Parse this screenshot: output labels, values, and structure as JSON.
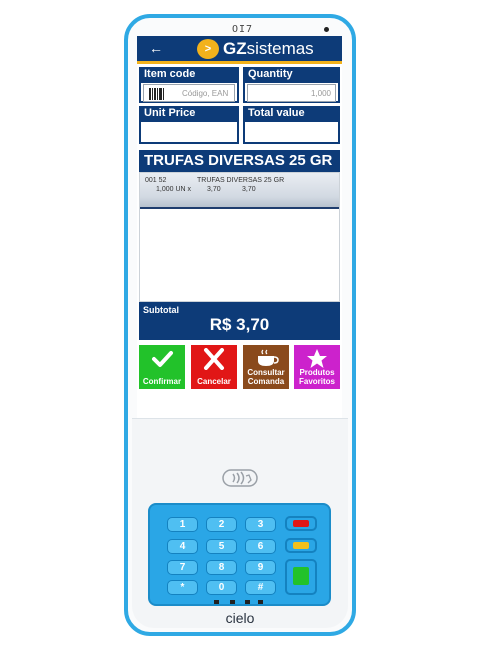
{
  "device": {
    "speaker_label": "OI7",
    "brand": "cielo"
  },
  "header": {
    "back_icon": "←",
    "logo_mark": ">",
    "logo_bold": "GZ",
    "logo_rest": "sistemas"
  },
  "form": {
    "item_code_label": "Item code",
    "item_code_placeholder": "Código, EAN",
    "quantity_label": "Quantity",
    "quantity_value": "1,000",
    "unit_price_label": "Unit Price",
    "total_value_label": "Total value"
  },
  "product_title": "TRUFAS DIVERSAS 25 GR",
  "items": [
    {
      "code": "001 52",
      "description": "TRUFAS DIVERSAS 25 GR",
      "qty": "1,000 UN x",
      "unit_price": "3,70",
      "total": "3,70"
    }
  ],
  "subtotal": {
    "label": "Subtotal",
    "value": "R$ 3,70"
  },
  "actions": [
    {
      "label": "Confirmar",
      "color": "#22c22a",
      "icon": "checkmark-icon"
    },
    {
      "label": "Cancelar",
      "color": "#e11616",
      "icon": "x-icon"
    },
    {
      "label": "Consultar Comanda",
      "color": "#8a4a1c",
      "icon": "coffee-cup-icon"
    },
    {
      "label": "Produtos Favoritos",
      "color": "#cc22cc",
      "icon": "star-icon"
    }
  ],
  "keypad": {
    "keys": [
      "1",
      "2",
      "3",
      "4",
      "5",
      "6",
      "7",
      "8",
      "9",
      "*",
      "0",
      "#"
    ],
    "function_colors": {
      "cancel": "#e11616",
      "clear": "#f2c01c",
      "enter": "#22c22a"
    }
  },
  "colors": {
    "primary": "#0d3b78",
    "accent": "#f2b21c",
    "device_frame": "#2fa9e4"
  }
}
